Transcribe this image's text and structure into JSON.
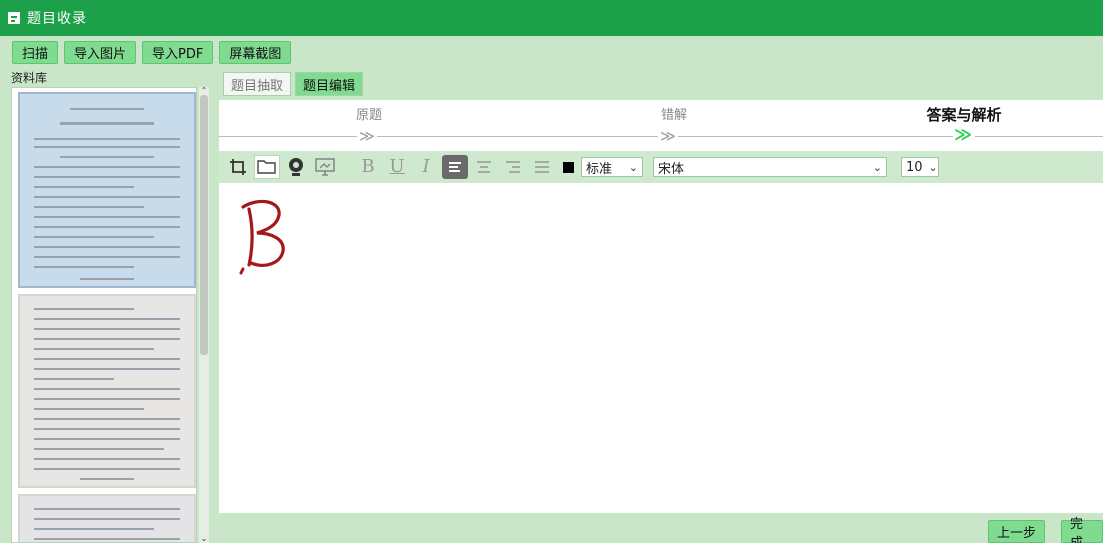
{
  "window": {
    "title": "题目收录",
    "icon": "window-icon"
  },
  "toolbar": {
    "scan_label": "扫描",
    "import_image_label": "导入图片",
    "import_pdf_label": "导入PDF",
    "screenshot_label": "屏幕截图"
  },
  "library": {
    "title": "资料库",
    "pages": 3
  },
  "tabs": [
    {
      "label": "题目抽取",
      "active": false
    },
    {
      "label": "题目编辑",
      "active": true
    }
  ],
  "steps": [
    {
      "label": "原题",
      "arrow": "≫",
      "current": false
    },
    {
      "label": "错解",
      "arrow": "≫",
      "current": false
    },
    {
      "label": "答案与解析",
      "arrow": "≫",
      "current": true
    }
  ],
  "editor_toolbar": {
    "icons": [
      "crop-icon",
      "folder-open-icon",
      "record-icon",
      "screen-capture-icon",
      "bold-icon",
      "underline-icon",
      "italic-icon",
      "align-left-icon",
      "align-center-icon",
      "align-right-icon",
      "justify-icon"
    ],
    "text_color": "#000000",
    "style_value": "标准",
    "font_value": "宋体",
    "size_value": "10"
  },
  "canvas": {
    "handwritten_answer": "B",
    "ink_color": "#a31818"
  },
  "footer": {
    "prev_label": "上一步",
    "finish_label": "完成"
  },
  "colors": {
    "titlebar": "#1ca04a",
    "button": "#7fdb8f",
    "panel": "#c9e6c9",
    "step_active": "#2fcf55"
  }
}
